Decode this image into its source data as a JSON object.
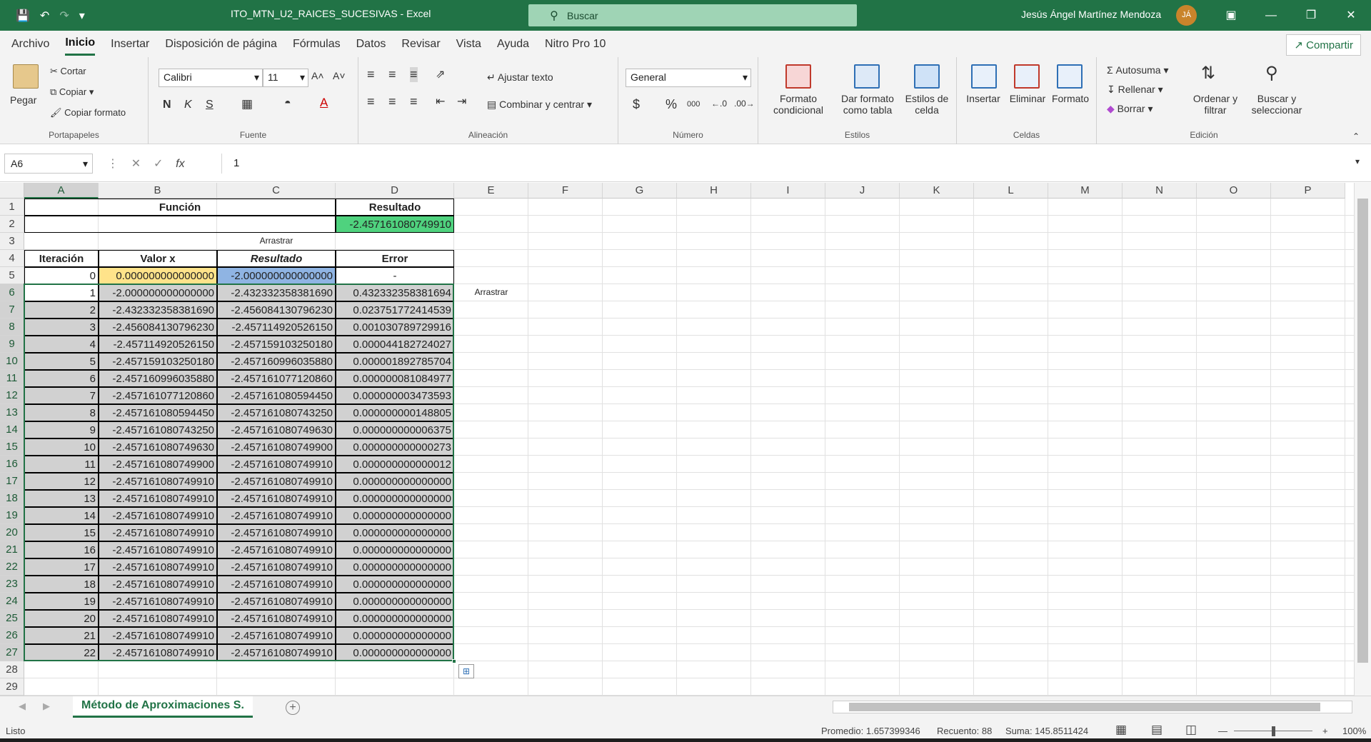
{
  "title_bar": {
    "doc_title": "ITO_MTN_U2_RAICES_SUCESIVAS  -  Excel",
    "search_placeholder": "Buscar",
    "user_name": "Jesús Ángel Martínez Mendoza",
    "user_initials": "JÁ"
  },
  "menu": {
    "tabs": [
      "Archivo",
      "Inicio",
      "Insertar",
      "Disposición de página",
      "Fórmulas",
      "Datos",
      "Revisar",
      "Vista",
      "Ayuda",
      "Nitro Pro 10"
    ],
    "active": "Inicio",
    "share_label": "Compartir"
  },
  "ribbon": {
    "portapapeles": {
      "paste": "Pegar",
      "cut": "Cortar",
      "copy": "Copiar",
      "format_painter": "Copiar formato",
      "label": "Portapapeles"
    },
    "fuente": {
      "font_name": "Calibri",
      "font_size": "11",
      "bold": "N",
      "italic": "K",
      "underline": "S",
      "label": "Fuente"
    },
    "alineacion": {
      "wrap": "Ajustar texto",
      "merge": "Combinar y centrar",
      "label": "Alineación"
    },
    "numero": {
      "format": "General",
      "label": "Número"
    },
    "estilos": {
      "cond": "Formato condicional",
      "table": "Dar formato como tabla",
      "cell_styles": "Estilos de celda",
      "label": "Estilos"
    },
    "celdas": {
      "insert": "Insertar",
      "delete": "Eliminar",
      "format": "Formato",
      "label": "Celdas"
    },
    "edicion": {
      "autosum": "Autosuma",
      "fill": "Rellenar",
      "clear": "Borrar",
      "sort": "Ordenar y filtrar",
      "find": "Buscar y seleccionar",
      "label": "Edición"
    }
  },
  "formula_bar": {
    "name_box": "A6",
    "formula": "1"
  },
  "columns": [
    "A",
    "B",
    "C",
    "D",
    "E",
    "F",
    "G",
    "H",
    "I",
    "J",
    "K",
    "L",
    "M",
    "N",
    "O",
    "P"
  ],
  "sheet": {
    "funcion_header": "Función",
    "resultado_header": "Resultado",
    "resultado_value": "-2.457161080749910",
    "arrastrar_c3": "Arrastrar",
    "arrastrar_e6": "Arrastrar",
    "headers": [
      "Iteración",
      "Valor x",
      "Resultado",
      "Error"
    ],
    "row5": [
      "0",
      "0.000000000000000",
      "-2.000000000000000",
      "-"
    ],
    "rows": [
      [
        "1",
        "-2.000000000000000",
        "-2.432332358381690",
        "0.432332358381694"
      ],
      [
        "2",
        "-2.432332358381690",
        "-2.456084130796230",
        "0.023751772414539"
      ],
      [
        "3",
        "-2.456084130796230",
        "-2.457114920526150",
        "0.001030789729916"
      ],
      [
        "4",
        "-2.457114920526150",
        "-2.457159103250180",
        "0.000044182724027"
      ],
      [
        "5",
        "-2.457159103250180",
        "-2.457160996035880",
        "0.000001892785704"
      ],
      [
        "6",
        "-2.457160996035880",
        "-2.457161077120860",
        "0.000000081084977"
      ],
      [
        "7",
        "-2.457161077120860",
        "-2.457161080594450",
        "0.000000003473593"
      ],
      [
        "8",
        "-2.457161080594450",
        "-2.457161080743250",
        "0.000000000148805"
      ],
      [
        "9",
        "-2.457161080743250",
        "-2.457161080749630",
        "0.000000000006375"
      ],
      [
        "10",
        "-2.457161080749630",
        "-2.457161080749900",
        "0.000000000000273"
      ],
      [
        "11",
        "-2.457161080749900",
        "-2.457161080749910",
        "0.000000000000012"
      ],
      [
        "12",
        "-2.457161080749910",
        "-2.457161080749910",
        "0.000000000000000"
      ],
      [
        "13",
        "-2.457161080749910",
        "-2.457161080749910",
        "0.000000000000000"
      ],
      [
        "14",
        "-2.457161080749910",
        "-2.457161080749910",
        "0.000000000000000"
      ],
      [
        "15",
        "-2.457161080749910",
        "-2.457161080749910",
        "0.000000000000000"
      ],
      [
        "16",
        "-2.457161080749910",
        "-2.457161080749910",
        "0.000000000000000"
      ],
      [
        "17",
        "-2.457161080749910",
        "-2.457161080749910",
        "0.000000000000000"
      ],
      [
        "18",
        "-2.457161080749910",
        "-2.457161080749910",
        "0.000000000000000"
      ],
      [
        "19",
        "-2.457161080749910",
        "-2.457161080749910",
        "0.000000000000000"
      ],
      [
        "20",
        "-2.457161080749910",
        "-2.457161080749910",
        "0.000000000000000"
      ],
      [
        "21",
        "-2.457161080749910",
        "-2.457161080749910",
        "0.000000000000000"
      ],
      [
        "22",
        "-2.457161080749910",
        "-2.457161080749910",
        "0.000000000000000"
      ]
    ]
  },
  "sheet_tab": "Método de Aproximaciones S.",
  "status": {
    "ready": "Listo",
    "average": "Promedio: 1.657399346",
    "count": "Recuento: 88",
    "sum": "Suma: 145.8511424",
    "zoom": "100%"
  },
  "colors": {
    "excel_green": "#217346",
    "resultado_fill": "#4fd27e",
    "valor_x_fill": "#ffe38a",
    "resultado_c5_fill": "#8fb4e3"
  }
}
